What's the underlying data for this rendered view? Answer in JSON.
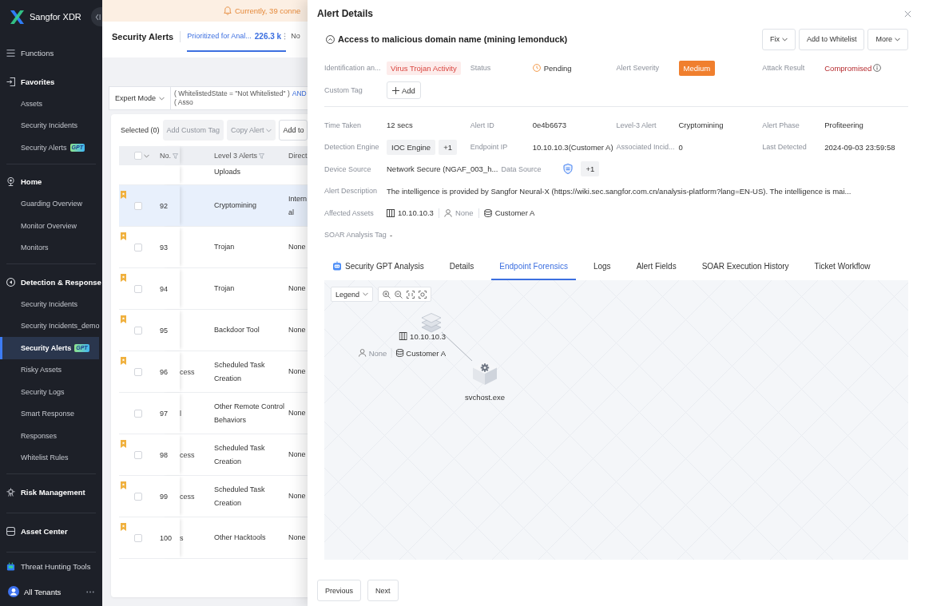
{
  "sidebar": {
    "brand": "Sangfor XDR",
    "items": [
      {
        "kind": "link",
        "label": "Functions"
      },
      {
        "kind": "group",
        "label": "Favorites",
        "children": [
          {
            "label": "Assets",
            "selected": false
          },
          {
            "label": "Security Incidents",
            "selected": false
          },
          {
            "label": "Security Alerts",
            "badge": "GPT",
            "selected": false
          }
        ]
      },
      {
        "kind": "group",
        "label": "Home",
        "children": [
          {
            "label": "Guarding Overview",
            "selected": false
          },
          {
            "label": "Monitor Overview",
            "selected": false
          },
          {
            "label": "Monitors",
            "selected": false
          }
        ]
      },
      {
        "kind": "group",
        "label": "Detection & Response",
        "children": [
          {
            "label": "Security Incidents",
            "selected": false
          },
          {
            "label": "Security Incidents_demo",
            "selected": false
          },
          {
            "label": "Security Alerts",
            "badge": "GPT",
            "selected": true
          },
          {
            "label": "Risky Assets",
            "selected": false
          },
          {
            "label": "Security Logs",
            "selected": false
          },
          {
            "label": "Smart Response",
            "selected": false
          },
          {
            "label": "Responses",
            "selected": false
          },
          {
            "label": "Whitelist Rules",
            "selected": false
          }
        ]
      },
      {
        "kind": "group",
        "label": "Risk Management"
      },
      {
        "kind": "group",
        "label": "Asset Center"
      },
      {
        "kind": "link",
        "label": "Threat Hunting Tools"
      }
    ],
    "footer": {
      "label": "All Tenants"
    }
  },
  "notice": {
    "text": "Currently, 39 conne"
  },
  "page_header": {
    "title": "Security Alerts",
    "tabs": [
      {
        "label": "Prioritized for Anal...",
        "count": "226.3 k",
        "selected": true
      },
      {
        "label": "No",
        "selected": false
      }
    ]
  },
  "filter_bar": {
    "mode": "Expert Mode",
    "query": [
      {
        "kind": "term",
        "text": "( WhitelistedState = \"Not Whitelisted\" )"
      },
      {
        "kind": "operator",
        "text": "AND"
      },
      {
        "kind": "term",
        "text": "( Asso"
      }
    ]
  },
  "table": {
    "selection": "Selected (0)",
    "actions": [
      {
        "label": "Add Custom Tag",
        "disabled": true,
        "dropdown": false
      },
      {
        "label": "Copy Alert",
        "disabled": true,
        "dropdown": true
      },
      {
        "label": "Add to",
        "disabled": false,
        "dropdown": false
      }
    ],
    "header_checked": false,
    "columns": [
      {
        "label": "No.",
        "filterable": true
      },
      {
        "label": "Level 3 Alerts",
        "filterable": true
      },
      {
        "label": "Direct",
        "filterable": false
      }
    ],
    "rows": [
      {
        "kind": "partial",
        "level3": "Uploads",
        "selected": false
      },
      {
        "kind": "row",
        "no": "92",
        "level3": "Cryptomining",
        "direction": "Internal",
        "flagged": true,
        "checked": false,
        "selected": true
      },
      {
        "kind": "row",
        "no": "93",
        "level3": "Trojan",
        "direction": "None",
        "flagged": true,
        "checked": false,
        "selected": false
      },
      {
        "kind": "row",
        "no": "94",
        "level3": "Trojan",
        "direction": "None",
        "flagged": true,
        "checked": false,
        "selected": false
      },
      {
        "kind": "row",
        "no": "95",
        "level3": "Backdoor Tool",
        "direction": "None",
        "flagged": true,
        "checked": false,
        "selected": false
      },
      {
        "kind": "row",
        "no": "96",
        "column_3": "cess",
        "level3": "Scheduled Task Creation",
        "direction": "None",
        "flagged": true,
        "checked": false,
        "selected": false
      },
      {
        "kind": "row",
        "no": "97",
        "column_3": "l",
        "level3": "Other Remote Control Behaviors",
        "direction": "None",
        "flagged": false,
        "checked": false,
        "selected": false
      },
      {
        "kind": "row",
        "no": "98",
        "column_3": "cess",
        "level3": "Scheduled Task Creation",
        "direction": "None",
        "flagged": true,
        "checked": false,
        "selected": false
      },
      {
        "kind": "row",
        "no": "99",
        "column_3": "cess",
        "level3": "Scheduled Task Creation",
        "direction": "None",
        "flagged": true,
        "checked": false,
        "selected": false
      },
      {
        "kind": "row",
        "no": "100",
        "column_3": "s",
        "level3": "Other Hacktools",
        "direction": "None",
        "flagged": true,
        "checked": false,
        "selected": false
      }
    ]
  },
  "drawer": {
    "title": "Alert Details",
    "alert_name": "Access to malicious domain name (mining lemonduck)",
    "actions": [
      {
        "label": "Fix",
        "dropdown": true
      },
      {
        "label": "Add to Whitelist",
        "dropdown": false
      },
      {
        "label": "More",
        "dropdown": true
      }
    ],
    "summary": [
      {
        "label": "Identification an...",
        "kind": "tag",
        "value": "Virus Trojan Activity"
      },
      {
        "label": "Status",
        "kind": "status",
        "value": "Pending"
      },
      {
        "label": "Alert Severity",
        "kind": "severity",
        "value": "Medium"
      },
      {
        "label": "Attack Result",
        "kind": "result",
        "value": "Compromised"
      },
      {
        "label": "Custom Tag",
        "kind": "add",
        "value": "Add"
      }
    ],
    "details": [
      [
        {
          "label": "Time Taken",
          "kind": "text",
          "value": "12 secs"
        },
        {
          "label": "Alert ID",
          "kind": "text",
          "value": "0e4b6673"
        },
        {
          "label": "Level-3 Alert",
          "kind": "text",
          "value": "Cryptomining"
        },
        {
          "label": "Alert Phase",
          "kind": "text",
          "value": "Profiteering"
        }
      ],
      [
        {
          "label": "Detection Engine",
          "kind": "chips",
          "values": [
            "IOC Engine",
            "+1"
          ]
        },
        {
          "label": "Endpoint IP",
          "kind": "text",
          "value": "10.10.10.3(Customer A)"
        },
        {
          "label": "Associated Incid...",
          "kind": "text",
          "value": "0"
        },
        {
          "label": "Last Detected",
          "kind": "text",
          "value": "2024-09-03 23:59:58"
        }
      ],
      [
        {
          "label": "Device Source",
          "kind": "text",
          "value": "Network Secure (NGAF_003_h..."
        },
        {
          "label": "Data Source",
          "kind": "source",
          "value": "+1"
        }
      ],
      [
        {
          "label": "Alert Description",
          "kind": "text",
          "value": "The intelligence is provided by Sangfor Neural-X (https://wiki.sec.sangfor.com.cn/analysis-platform?lang=EN-US). The intelligence is mai..."
        }
      ],
      [
        {
          "label": "Affected Assets",
          "kind": "assets",
          "host": "10.10.10.3",
          "user": "None",
          "tenant": "Customer A"
        }
      ],
      [
        {
          "label": "SOAR Analysis Tag",
          "kind": "text",
          "value": "-"
        }
      ]
    ],
    "tabs": [
      {
        "label": "Security GPT Analysis",
        "kind": "gpt",
        "selected": false
      },
      {
        "label": "Details",
        "kind": "plain",
        "selected": false
      },
      {
        "label": "Endpoint Forensics",
        "kind": "plain",
        "selected": true
      },
      {
        "label": "Logs",
        "kind": "plain",
        "selected": false
      },
      {
        "label": "Alert Fields",
        "kind": "plain",
        "selected": false
      },
      {
        "label": "SOAR Execution History",
        "kind": "plain",
        "selected": false
      },
      {
        "label": "Ticket Workflow",
        "kind": "plain",
        "selected": false
      }
    ],
    "graph": {
      "legend": "Legend",
      "nodes": [
        {
          "kind": "host",
          "label": "10.10.10.3",
          "user": "None",
          "tenant": "Customer A",
          "children": [
            {
              "kind": "process",
              "label": "svchost.exe"
            }
          ]
        }
      ]
    },
    "footer_buttons": [
      "Previous",
      "Next"
    ]
  }
}
